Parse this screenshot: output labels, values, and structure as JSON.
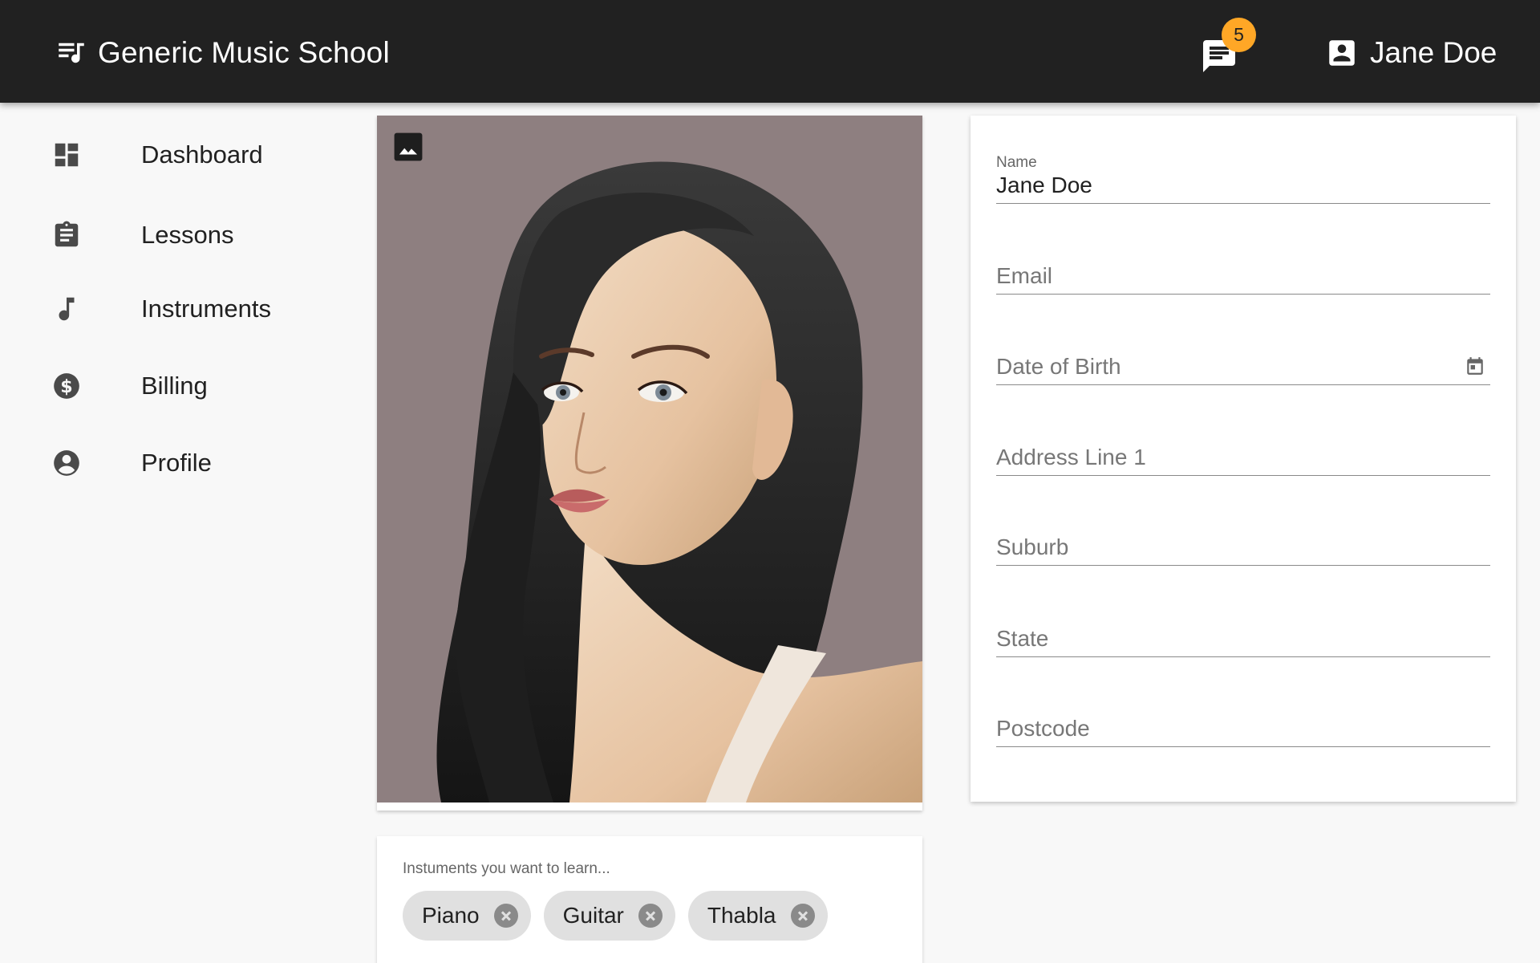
{
  "app": {
    "title": "Generic Music School",
    "brand_icon": "queue-music-icon"
  },
  "header": {
    "notifications_count": "5",
    "user_name": "Jane Doe",
    "colors": {
      "bar": "#212121",
      "badge": "#ffa726"
    }
  },
  "sidebar": {
    "items": [
      {
        "label": "Dashboard",
        "icon": "dashboard-icon"
      },
      {
        "label": "Lessons",
        "icon": "clipboard-icon"
      },
      {
        "label": "Instruments",
        "icon": "music-note-icon"
      },
      {
        "label": "Billing",
        "icon": "dollar-circle-icon"
      },
      {
        "label": "Profile",
        "icon": "account-circle-icon"
      }
    ]
  },
  "instruments": {
    "label": "Instuments you want to learn...",
    "chips": [
      "Piano",
      "Guitar",
      "Thabla"
    ]
  },
  "form": {
    "name_label": "Name",
    "name_value": "Jane Doe",
    "email_placeholder": "Email",
    "dob_placeholder": "Date of Birth",
    "address_placeholder": "Address Line 1",
    "suburb_placeholder": "Suburb",
    "state_placeholder": "State",
    "postcode_placeholder": "Postcode"
  }
}
